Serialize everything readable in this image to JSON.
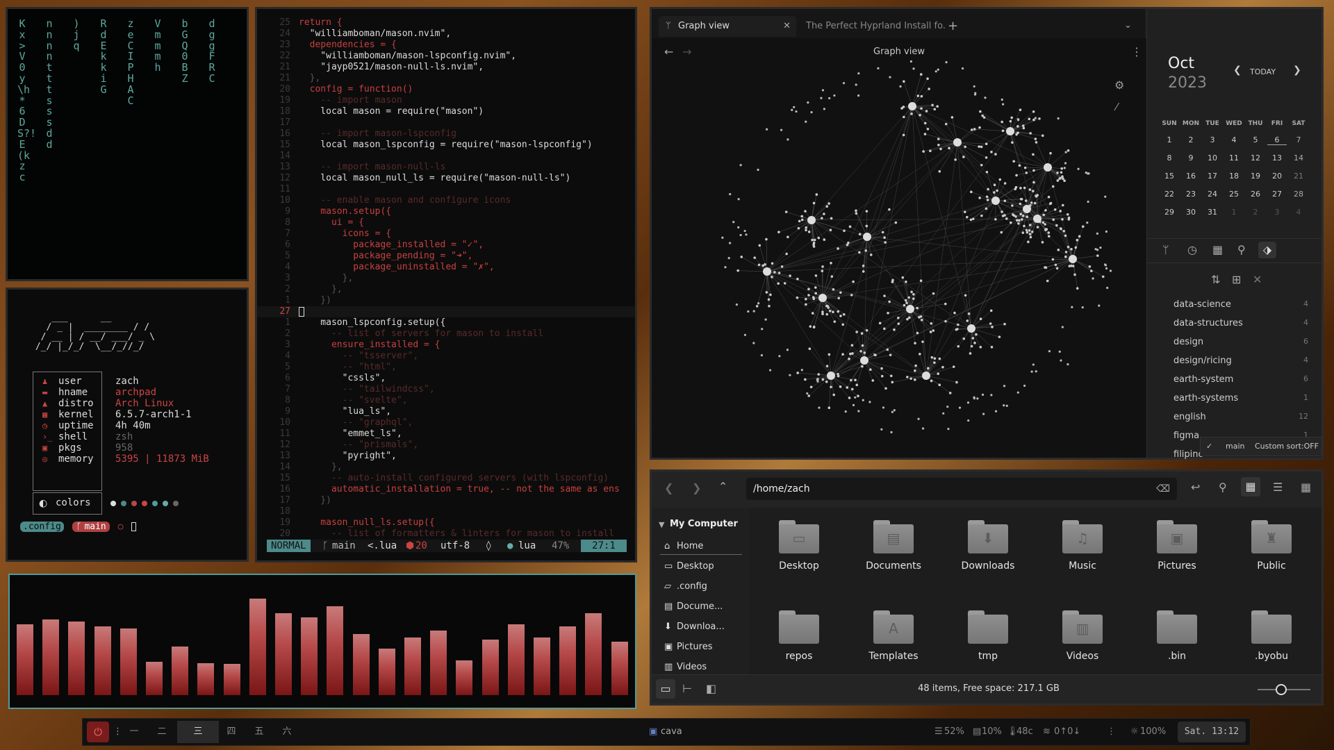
{
  "matrix": {
    "columns": [
      "Kx>V0y\\h*6DS?!E(kzc",
      "",
      "",
      "",
      "",
      "",
      "nnnntttsssdd",
      "",
      "",
      "",
      "",
      "",
      ")jq",
      "",
      "",
      "",
      "",
      "",
      "RdEkkiG",
      "",
      "",
      "",
      "",
      "",
      "zeCIPHAC",
      "",
      "",
      "",
      "",
      "",
      "Vmmmh",
      "",
      "",
      "",
      "",
      "",
      "bGQ0BZ",
      "",
      "",
      "",
      "",
      "",
      "dggFRC"
    ]
  },
  "fetch": {
    "ascii": "    ___      __\n   / _ |  ________ / /\n  / __ | / __/ ___/ _ \\\n /_/ |_/_/  \\__/_//_/",
    "rows": [
      {
        "icon": "user-icon",
        "key": "user",
        "value": "zach",
        "tone": "a"
      },
      {
        "icon": "host-icon",
        "key": "hname",
        "value": "archpad",
        "tone": "r"
      },
      {
        "icon": "arch-icon",
        "key": "distro",
        "value": "Arch Linux",
        "tone": "r"
      },
      {
        "icon": "kernel-icon",
        "key": "kernel",
        "value": "6.5.7-arch1-1",
        "tone": "a"
      },
      {
        "icon": "clock-icon",
        "key": "uptime",
        "value": "4h 40m",
        "tone": "a"
      },
      {
        "icon": "shell-icon",
        "key": "shell",
        "value": "zsh",
        "tone": "d"
      },
      {
        "icon": "package-icon",
        "key": "pkgs",
        "value": "958",
        "tone": "d"
      },
      {
        "icon": "memory-icon",
        "key": "memory",
        "value": "5395 | 11873 MiB",
        "tone": "r"
      }
    ],
    "colors_label": "colors",
    "swatches": [
      "#dddddd",
      "#4d8a8a",
      "#b94747",
      "#c44",
      "#4d9c9c",
      "#6aa",
      "#666"
    ],
    "prompt_dir": ".config",
    "prompt_branch": "main",
    "prompt_symbol": "○"
  },
  "editor": {
    "lines": [
      {
        "n": "25",
        "t": "return {",
        "c": "#c84040"
      },
      {
        "n": "24",
        "t": "  \"williamboman/mason.nvim\",",
        "c": "#dddddd"
      },
      {
        "n": "23",
        "t": "  dependencies = {",
        "c": "#c84040"
      },
      {
        "n": "22",
        "t": "    \"williamboman/mason-lspconfig.nvim\",",
        "c": "#dddddd"
      },
      {
        "n": "21",
        "t": "    \"jayp0521/mason-null-ls.nvim\",",
        "c": "#dddddd"
      },
      {
        "n": "21",
        "t": "  },",
        "c": "#555555"
      },
      {
        "n": "20",
        "t": "  config = function()",
        "c": "#c84040"
      },
      {
        "n": "19",
        "t": "    -- import mason",
        "c": "#5a2a2a"
      },
      {
        "n": "18",
        "t": "    local mason = require(\"mason\")",
        "c": "#dddddd"
      },
      {
        "n": "17",
        "t": "",
        "c": "#555555"
      },
      {
        "n": "16",
        "t": "    -- import mason-lspconfig",
        "c": "#5a2a2a"
      },
      {
        "n": "15",
        "t": "    local mason_lspconfig = require(\"mason-lspconfig\")",
        "c": "#dddddd"
      },
      {
        "n": "14",
        "t": "",
        "c": "#555555"
      },
      {
        "n": "13",
        "t": "    -- import mason-null-ls",
        "c": "#5a2a2a"
      },
      {
        "n": "12",
        "t": "    local mason_null_ls = require(\"mason-null-ls\")",
        "c": "#dddddd"
      },
      {
        "n": "11",
        "t": "",
        "c": "#555555"
      },
      {
        "n": "10",
        "t": "    -- enable mason and configure icons",
        "c": "#5a2a2a"
      },
      {
        "n": "9",
        "t": "    mason.setup({",
        "c": "#c84040"
      },
      {
        "n": "8",
        "t": "      ui = {",
        "c": "#c84040"
      },
      {
        "n": "7",
        "t": "        icons = {",
        "c": "#c84040"
      },
      {
        "n": "6",
        "t": "          package_installed = \"✓\",",
        "c": "#c84040"
      },
      {
        "n": "5",
        "t": "          package_pending = \"➜\",",
        "c": "#c84040"
      },
      {
        "n": "4",
        "t": "          package_uninstalled = \"✗\",",
        "c": "#c84040"
      },
      {
        "n": "3",
        "t": "        },",
        "c": "#555555"
      },
      {
        "n": "2",
        "t": "      },",
        "c": "#555555"
      },
      {
        "n": "1",
        "t": "    })",
        "c": "#555555"
      },
      {
        "n": "27",
        "t": "",
        "c": "#dddddd"
      },
      {
        "n": "1",
        "t": "    mason_lspconfig.setup({",
        "c": "#dddddd"
      },
      {
        "n": "2",
        "t": "      -- list of servers for mason to install",
        "c": "#5a2a2a"
      },
      {
        "n": "3",
        "t": "      ensure_installed = {",
        "c": "#c84040"
      },
      {
        "n": "4",
        "t": "        -- \"tsserver\",",
        "c": "#5a2a2a"
      },
      {
        "n": "5",
        "t": "        -- \"html\",",
        "c": "#5a2a2a"
      },
      {
        "n": "6",
        "t": "        \"cssls\",",
        "c": "#dddddd"
      },
      {
        "n": "7",
        "t": "        -- \"tailwindcss\",",
        "c": "#5a2a2a"
      },
      {
        "n": "8",
        "t": "        -- \"svelte\",",
        "c": "#5a2a2a"
      },
      {
        "n": "9",
        "t": "        \"lua_ls\",",
        "c": "#dddddd"
      },
      {
        "n": "10",
        "t": "        -- \"graphql\",",
        "c": "#5a2a2a"
      },
      {
        "n": "11",
        "t": "        \"emmet_ls\",",
        "c": "#dddddd"
      },
      {
        "n": "12",
        "t": "        -- \"prismals\",",
        "c": "#5a2a2a"
      },
      {
        "n": "13",
        "t": "        \"pyright\",",
        "c": "#dddddd"
      },
      {
        "n": "14",
        "t": "      },",
        "c": "#555555"
      },
      {
        "n": "15",
        "t": "      -- auto-install configured servers (with lspconfig)",
        "c": "#5a2a2a"
      },
      {
        "n": "16",
        "t": "      automatic_installation = true, -- not the same as ens",
        "c": "#c84040"
      },
      {
        "n": "17",
        "t": "    })",
        "c": "#555555"
      },
      {
        "n": "18",
        "t": "",
        "c": "#555555"
      },
      {
        "n": "19",
        "t": "    mason_null_ls.setup({",
        "c": "#c84040"
      },
      {
        "n": "20",
        "t": "      -- list of formatters & linters for mason to install",
        "c": "#5a2a2a"
      }
    ],
    "status": {
      "mode": "NORMAL",
      "branch": "main",
      "file": "<.lua",
      "diag": "20",
      "enc": "utf-8",
      "ft": "lua",
      "pct": "47%",
      "pos": "27:1"
    }
  },
  "cava": {
    "values": [
      64,
      68,
      66,
      62,
      60,
      30,
      44,
      29,
      28,
      87,
      74,
      70,
      80,
      55,
      42,
      52,
      58,
      31,
      50,
      64,
      52,
      62,
      74,
      48
    ]
  },
  "obsidian": {
    "tabs": [
      {
        "label": "Graph view",
        "active": true
      },
      {
        "label": "The Perfect Hyprland Install fo...",
        "active": false
      }
    ],
    "view_title": "Graph view",
    "calendar": {
      "month": "Oct",
      "year": "2023",
      "today_label": "TODAY",
      "days": [
        "SUN",
        "MON",
        "TUE",
        "WED",
        "THU",
        "FRI",
        "SAT"
      ],
      "weeks": [
        [
          "1",
          "2",
          "3",
          "4",
          "5",
          "6",
          "7"
        ],
        [
          "8",
          "9",
          "10",
          "11",
          "12",
          "13",
          "14"
        ],
        [
          "15",
          "16",
          "17",
          "18",
          "19",
          "20",
          "21"
        ],
        [
          "22",
          "23",
          "24",
          "25",
          "26",
          "27",
          "28"
        ],
        [
          "29",
          "30",
          "31",
          "1",
          "2",
          "3",
          "4"
        ]
      ]
    },
    "tags": [
      {
        "name": "data-science",
        "count": "4"
      },
      {
        "name": "data-structures",
        "count": "4"
      },
      {
        "name": "design",
        "count": "6"
      },
      {
        "name": "design/ricing",
        "count": "4"
      },
      {
        "name": "earth-system",
        "count": "6"
      },
      {
        "name": "earth-systems",
        "count": "1"
      },
      {
        "name": "english",
        "count": "12"
      },
      {
        "name": "figma",
        "count": "1"
      },
      {
        "name": "filipino",
        "count": ""
      }
    ],
    "branch": "main",
    "sort": "Custom sort:OFF"
  },
  "files": {
    "path": "/home/zach",
    "sidebar_header": "My Computer",
    "sidebar": [
      {
        "icon": "home-icon",
        "label": "Home"
      },
      {
        "icon": "desktop-icon",
        "label": "Desktop"
      },
      {
        "icon": "folder-icon",
        "label": ".config"
      },
      {
        "icon": "document-icon",
        "label": "Docume..."
      },
      {
        "icon": "download-icon",
        "label": "Downloa..."
      },
      {
        "icon": "picture-icon",
        "label": "Pictures"
      },
      {
        "icon": "video-icon",
        "label": "Videos"
      }
    ],
    "folders": [
      {
        "label": "Desktop",
        "sym": "▭"
      },
      {
        "label": "Documents",
        "sym": "▤"
      },
      {
        "label": "Downloads",
        "sym": "⬇"
      },
      {
        "label": "Music",
        "sym": "♫"
      },
      {
        "label": "Pictures",
        "sym": "▣"
      },
      {
        "label": "Public",
        "sym": "♜"
      },
      {
        "label": "repos",
        "sym": ""
      },
      {
        "label": "Templates",
        "sym": "A"
      },
      {
        "label": "tmp",
        "sym": ""
      },
      {
        "label": "Videos",
        "sym": "▥"
      },
      {
        "label": ".bin",
        "sym": ""
      },
      {
        "label": ".byobu",
        "sym": ""
      }
    ],
    "status": "48 items, Free space: 217.1 GB"
  },
  "taskbar": {
    "workspaces": [
      "一",
      "二",
      "三",
      "四",
      "五",
      "六"
    ],
    "active_window": "cava",
    "cpu": "52%",
    "mem": "10%",
    "temp": "48c",
    "net": "0↑0↓",
    "brightness": "100%",
    "clock": "Sat. 13:12"
  }
}
